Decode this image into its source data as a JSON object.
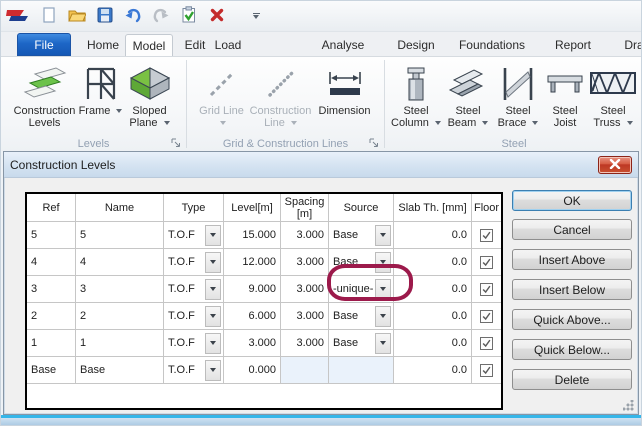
{
  "qat": {
    "icons": [
      "app-logo",
      "new-document",
      "open",
      "save",
      "undo",
      "redo",
      "validate",
      "delete",
      "toolbar-options"
    ]
  },
  "tabs": [
    {
      "label": "File"
    },
    {
      "label": "Home"
    },
    {
      "label": "Model",
      "active": true
    },
    {
      "label": "Edit"
    },
    {
      "label": "Load"
    },
    {
      "label": "Analyse"
    },
    {
      "label": "Design"
    },
    {
      "label": "Foundations"
    },
    {
      "label": "Report"
    },
    {
      "label": "Dra"
    }
  ],
  "ribbon": {
    "groups": [
      {
        "label": "Levels",
        "items": [
          {
            "label": "Construction Levels",
            "dropdown": false,
            "disabled": false
          },
          {
            "label": "Frame",
            "dropdown": true,
            "disabled": false
          },
          {
            "label": "Sloped Plane",
            "dropdown": true,
            "disabled": false
          }
        ]
      },
      {
        "label": "Grid & Construction Lines",
        "items": [
          {
            "label": "Grid Line",
            "dropdown": true,
            "disabled": true
          },
          {
            "label": "Construction Line",
            "dropdown": true,
            "disabled": true
          },
          {
            "label": "Dimension",
            "dropdown": false,
            "disabled": false
          }
        ]
      },
      {
        "label": "Steel",
        "items": [
          {
            "label": "Steel Column",
            "dropdown": true,
            "disabled": false
          },
          {
            "label": "Steel Beam",
            "dropdown": true,
            "disabled": false
          },
          {
            "label": "Steel Brace",
            "dropdown": true,
            "disabled": false
          },
          {
            "label": "Steel Joist",
            "dropdown": false,
            "disabled": false
          },
          {
            "label": "Steel Truss",
            "dropdown": true,
            "disabled": false
          }
        ]
      }
    ]
  },
  "dialog": {
    "title": "Construction Levels",
    "table": {
      "headers": [
        "Ref",
        "Name",
        "Type",
        "Level[m]",
        "Spacing [m]",
        "Source",
        "Slab Th. [mm]",
        "Floor"
      ],
      "rows": [
        {
          "ref": "5",
          "name": "5",
          "type": "T.O.F",
          "level": "15.000",
          "spacing": "3.000",
          "source": "Base",
          "slab_th": "0.0",
          "floor": true
        },
        {
          "ref": "4",
          "name": "4",
          "type": "T.O.F",
          "level": "12.000",
          "spacing": "3.000",
          "source": "Base",
          "slab_th": "0.0",
          "floor": true
        },
        {
          "ref": "3",
          "name": "3",
          "type": "T.O.F",
          "level": "9.000",
          "spacing": "3.000",
          "source": "-unique-",
          "slab_th": "0.0",
          "floor": true,
          "annotated": true
        },
        {
          "ref": "2",
          "name": "2",
          "type": "T.O.F",
          "level": "6.000",
          "spacing": "3.000",
          "source": "Base",
          "slab_th": "0.0",
          "floor": true
        },
        {
          "ref": "1",
          "name": "1",
          "type": "T.O.F",
          "level": "3.000",
          "spacing": "3.000",
          "source": "Base",
          "slab_th": "0.0",
          "floor": true
        },
        {
          "ref": "Base",
          "name": "Base",
          "type": "T.O.F",
          "level": "0.000",
          "spacing": "",
          "source": "",
          "slab_th": "0.0",
          "floor": true
        }
      ]
    },
    "buttons": [
      "OK",
      "Cancel",
      "Insert Above",
      "Insert Below",
      "Quick Above...",
      "Quick Below...",
      "Delete"
    ],
    "annotation": {
      "shape": "ellipse",
      "color": "#9c1a4b",
      "target": "Source dropdown of level 3 row showing -unique-"
    }
  },
  "colors": {
    "file_tab_blue": "#1d66c6",
    "annotation_red": "#9c1a4b",
    "close_button_red": "#bd3723",
    "status_cyan": "#35b6e9",
    "readonly_cell": "#eaf2fb"
  }
}
